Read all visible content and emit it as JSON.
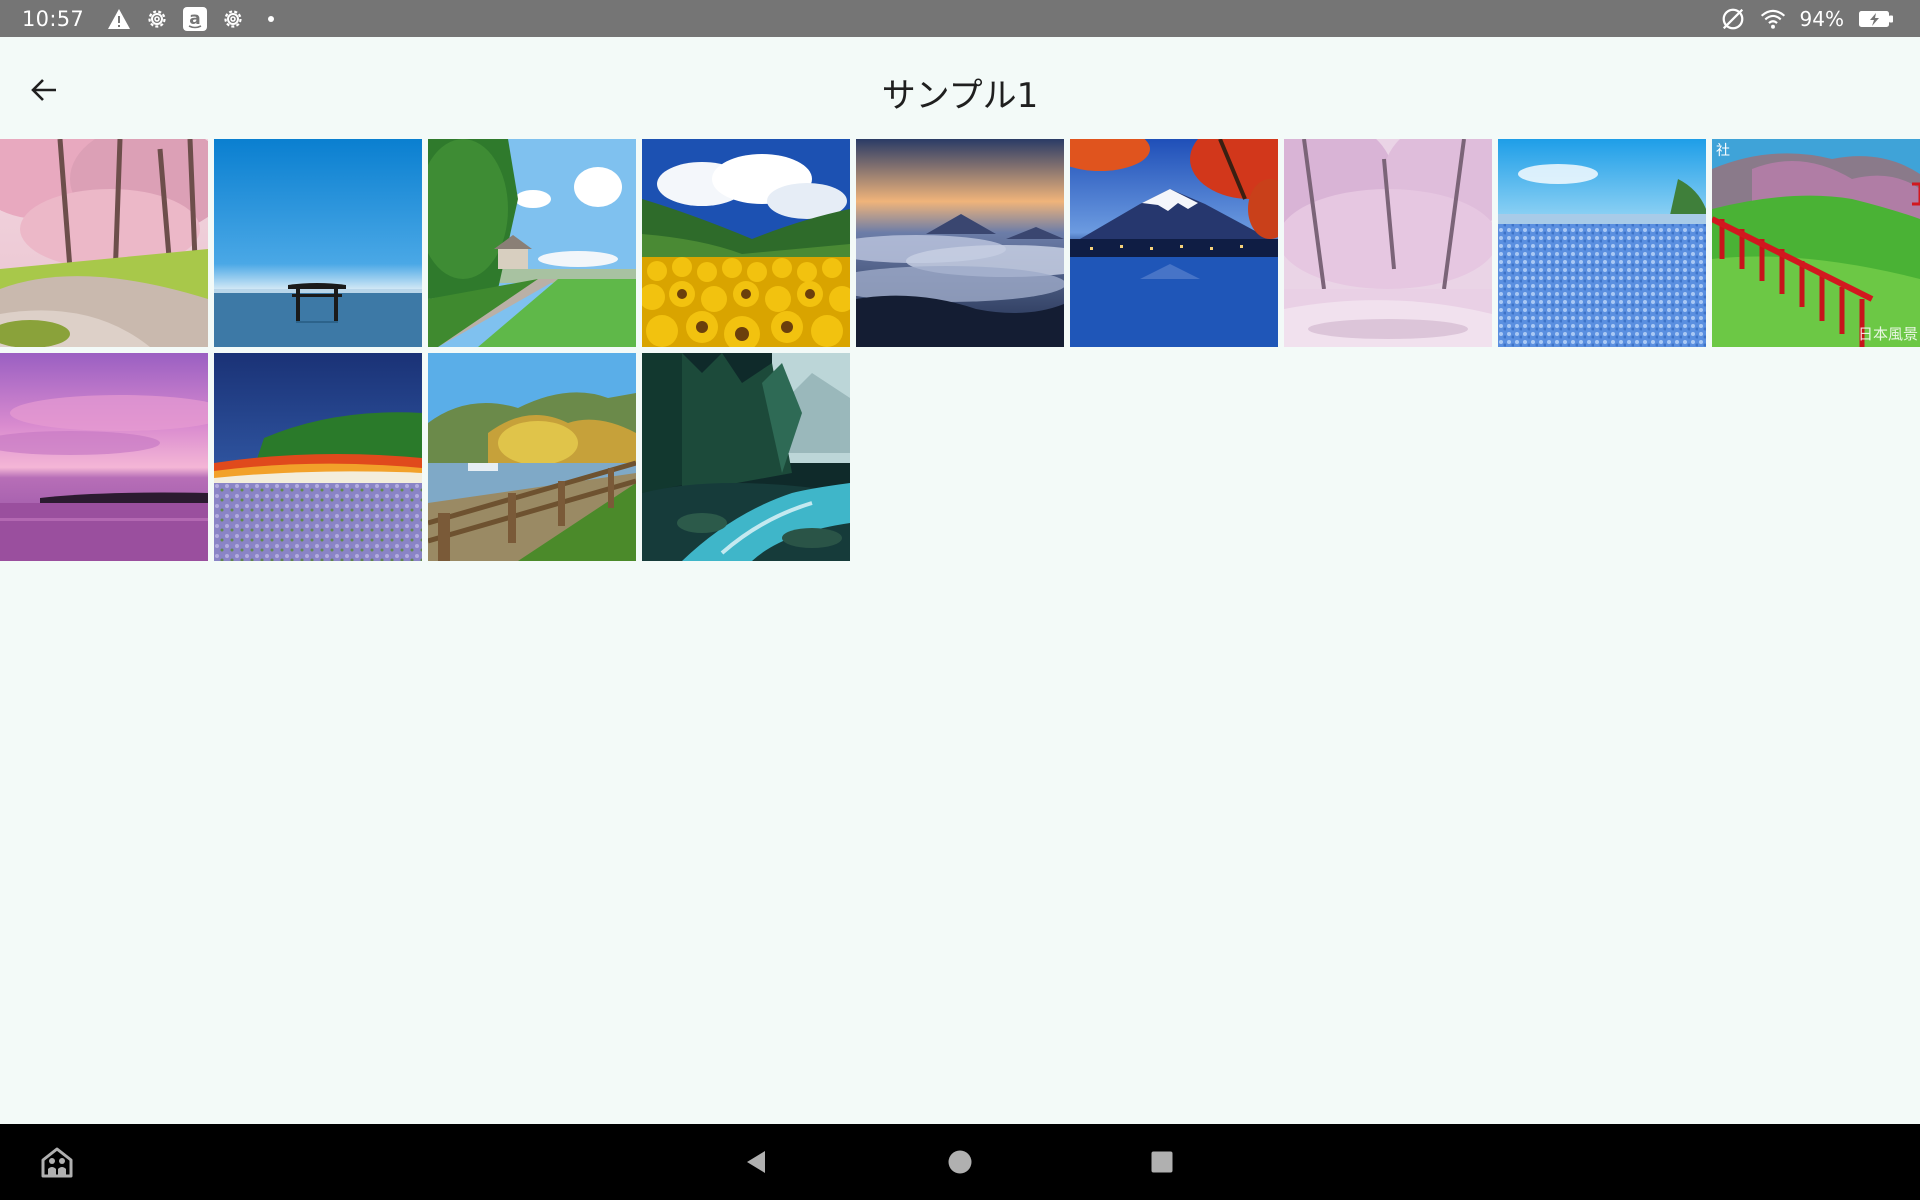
{
  "status_bar": {
    "time": "10:57",
    "icons_left": [
      "warning-icon",
      "settings-icon",
      "amazon-icon",
      "settings-icon",
      "dot-icon"
    ],
    "icons_right": [
      "sync-off-icon",
      "wifi-icon",
      "battery-charging-icon"
    ],
    "battery": "94%",
    "battery_level": 0.94
  },
  "app_bar": {
    "back_icon": "arrow-back-icon",
    "title": "サンプル1"
  },
  "gallery": {
    "count": 13,
    "items": [
      {
        "subject": "cherry-blossom-path"
      },
      {
        "subject": "torii-gate-in-sea"
      },
      {
        "subject": "country-road-with-house"
      },
      {
        "subject": "sunflower-field"
      },
      {
        "subject": "sea-of-clouds-at-dawn"
      },
      {
        "subject": "mount-fuji-with-autumn-leaves"
      },
      {
        "subject": "cherry-blossom-tunnel"
      },
      {
        "subject": "nemophila-field"
      },
      {
        "subject": "red-torii-on-green-hill"
      },
      {
        "subject": "purple-sunset-over-sea"
      },
      {
        "subject": "flower-field-with-forest"
      },
      {
        "subject": "autumn-lake-with-fence"
      },
      {
        "subject": "forest-stream"
      }
    ],
    "watermark_text_tile9": "日本風景"
  },
  "nav_bar": {
    "icons": [
      "kids-home-icon",
      "nav-back-icon",
      "nav-home-icon",
      "nav-recents-icon"
    ]
  },
  "colors": {
    "status_bar": "#757575",
    "background": "#f3faf8",
    "nav_bar": "#000000"
  }
}
